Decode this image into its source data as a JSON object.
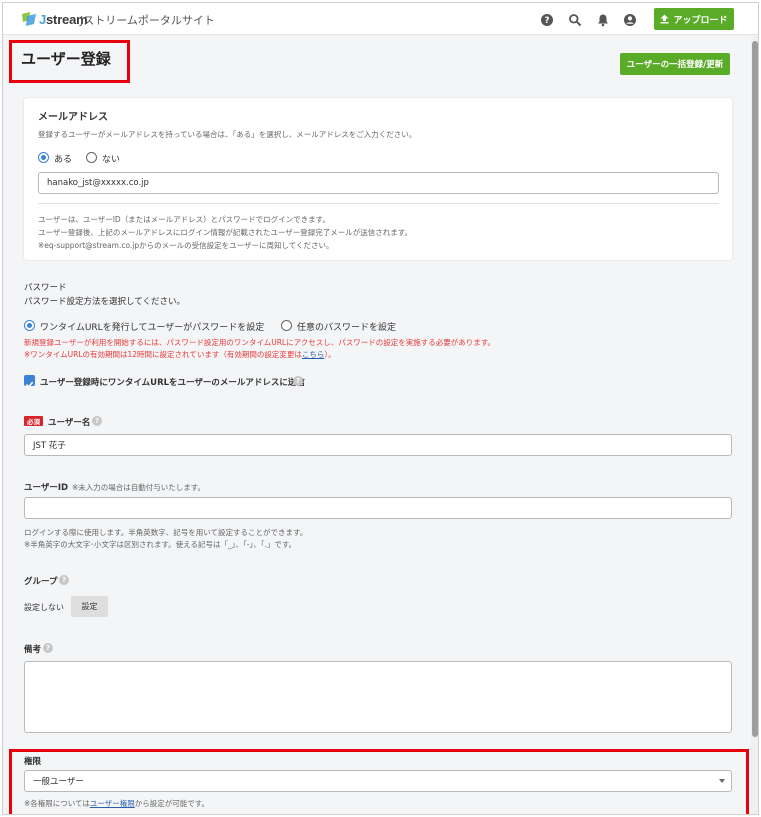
{
  "header": {
    "logo_prefix": "J",
    "logo_rest": "stream",
    "portal_title": "Jストリームポータルサイト",
    "icons": [
      "help-icon",
      "search-icon",
      "bell-icon",
      "user-icon"
    ],
    "upload_label": "アップロード"
  },
  "page": {
    "title": "ユーザー登録",
    "bulk_button": "ユーザーの一括登録/更新"
  },
  "email": {
    "heading": "メールアドレス",
    "description": "登録するユーザーがメールアドレスを持っている場合は、「ある」を選択し、メールアドレスをご入力ください。",
    "option_yes": "ある",
    "option_no": "ない",
    "selected": "ある",
    "value": "hanako_jst@xxxxx.co.jp",
    "notes": [
      "ユーザーは、ユーザーID（またはメールアドレス）とパスワードでログインできます。",
      "ユーザー登録後、上記のメールアドレスにログイン情報が記載されたユーザー登録完了メールが送信されます。",
      "※eq-support@stream.co.jpからのメールの受信設定をユーザーに周知してください。"
    ]
  },
  "password": {
    "heading": "パスワード",
    "description": "パスワード設定方法を選択してください。",
    "option_onetime": "ワンタイムURLを発行してユーザーがパスワードを設定",
    "option_custom": "任意のパスワードを設定",
    "selected": "ワンタイムURLを発行してユーザーがパスワードを設定",
    "warning_1": "新規登録ユーザーが利用を開始するには、パスワード設定用のワンタイムURLにアクセスし、パスワードの設定を実施する必要があります。",
    "warning_2": "※ワンタイムURLの有効期間は12時間に設定されています（有効期間の設定変更は",
    "warning_link": "こちら",
    "warning_end": "）。",
    "send_checkbox_label": "ユーザー登録時にワンタイムURLをユーザーのメールアドレスに送信",
    "send_checked": true
  },
  "username": {
    "required_badge": "必須",
    "label": "ユーザー名",
    "value": "JST 花子"
  },
  "userid": {
    "label": "ユーザーID",
    "hint": "※未入力の場合は自動付与いたします。",
    "value": "",
    "note_1": "ログインする際に使用します。半角英数字、記号を用いて設定することができます。",
    "note_2": "※半角英字の大文字･小文字は区別されます。使える記号は「_」、「-」、「.」です。"
  },
  "group": {
    "label": "グループ",
    "status": "設定しない",
    "button": "設定"
  },
  "remarks": {
    "label": "備考",
    "value": ""
  },
  "role": {
    "label": "権限",
    "selected": "一般ユーザー",
    "note_prefix": "※各権限については",
    "note_link": "ユーザー権限",
    "note_suffix": "から設定が可能です。"
  },
  "colors": {
    "accent_green": "#5aab28",
    "radio_blue": "#3b82d6",
    "highlight_red": "#e8000b",
    "warning_red": "#e83a3a"
  }
}
